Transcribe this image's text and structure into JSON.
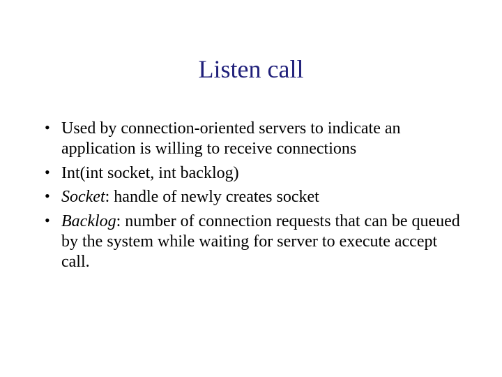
{
  "title": "Listen call",
  "bullets": [
    {
      "text": "Used by connection-oriented servers to indicate an application is willing to receive connections"
    },
    {
      "text": "Int(int socket, int backlog)"
    },
    {
      "term": "Socket",
      "rest": ":  handle of newly creates socket"
    },
    {
      "term": "Backlog",
      "rest": ":  number of connection requests that can be queued by the system while waiting for server to execute accept call."
    }
  ]
}
